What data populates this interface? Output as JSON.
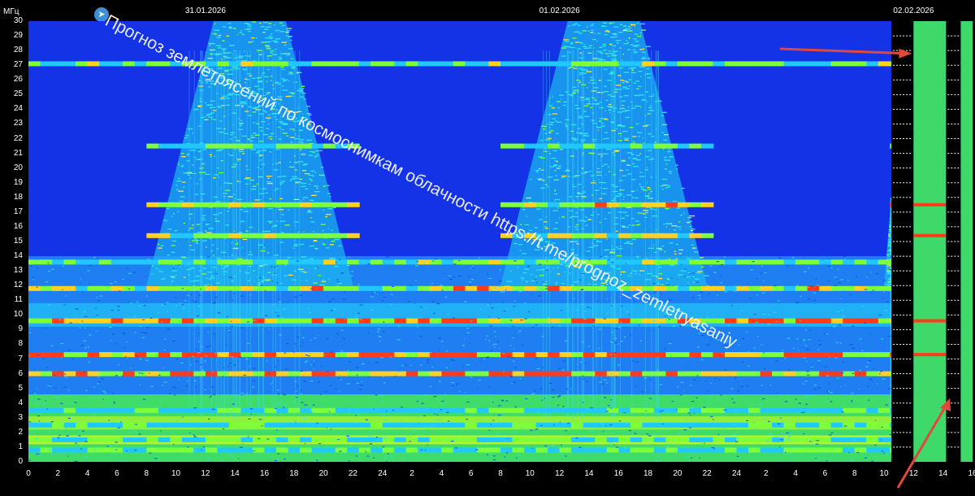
{
  "header": {
    "unit_label": "МГц",
    "dates": [
      "31.01.2026",
      "01.02.2026",
      "02.02.2026"
    ]
  },
  "watermark": {
    "text": "Прогноз землетрясений по космоснимкам облачности  https://t.me/prognoz_zemletryasaniy",
    "icon": "telegram-icon"
  },
  "colors": {
    "background": "#1433e6",
    "low": "#1a3fff",
    "mid": "#20c8ff",
    "high": "#7dff3a",
    "peak": "#ff3b1a",
    "gap": "#000000",
    "arrow": "#e0483a"
  },
  "chart_data": {
    "type": "heatmap",
    "title": "",
    "xlabel": "",
    "ylabel": "МГц",
    "ylim": [
      0,
      30
    ],
    "yticks": [
      "0",
      "1",
      "2",
      "3",
      "4",
      "5",
      "6",
      "7",
      "8",
      "9",
      "10",
      "11",
      "12",
      "13",
      "14",
      "15",
      "16",
      "17",
      "18",
      "19",
      "20",
      "21",
      "22",
      "23",
      "24",
      "25",
      "26",
      "27",
      "28",
      "29",
      "30"
    ],
    "xticks": [
      "0",
      "2",
      "4",
      "6",
      "8",
      "10",
      "12",
      "14",
      "16",
      "18",
      "20",
      "22",
      "24",
      "2",
      "4",
      "6",
      "8",
      "10",
      "12",
      "14",
      "16",
      "18",
      "20",
      "22",
      "24",
      "2",
      "4",
      "6",
      "8",
      "10",
      "12",
      "14",
      "16"
    ],
    "x_hours_total": 64,
    "date_markers": [
      {
        "label": "31.01.2026",
        "hour": 12
      },
      {
        "label": "01.02.2026",
        "hour": 36
      },
      {
        "label": "02.02.2026",
        "hour": 60
      }
    ],
    "strong_bands_mhz": [
      {
        "freq": 0.8,
        "intensity": 0.55
      },
      {
        "freq": 1.5,
        "intensity": 0.55
      },
      {
        "freq": 2.5,
        "intensity": 0.5
      },
      {
        "freq": 3.5,
        "intensity": 0.5
      },
      {
        "freq": 6.0,
        "intensity": 0.85
      },
      {
        "freq": 7.3,
        "intensity": 0.9
      },
      {
        "freq": 9.6,
        "intensity": 0.9
      },
      {
        "freq": 11.8,
        "intensity": 0.75
      },
      {
        "freq": 13.6,
        "intensity": 0.6
      },
      {
        "freq": 15.4,
        "intensity": 0.7
      },
      {
        "freq": 17.5,
        "intensity": 0.8
      },
      {
        "freq": 21.5,
        "intensity": 0.55
      },
      {
        "freq": 27.1,
        "intensity": 0.6
      }
    ],
    "daytime_activity_windows_hours": [
      [
        8,
        22
      ],
      [
        32,
        46
      ],
      [
        58,
        60
      ]
    ],
    "data_gaps_hours": [
      [
        58.5,
        60.0
      ],
      [
        62.2,
        63.2
      ]
    ],
    "annotations": [
      {
        "type": "arrow",
        "points_to_hour": 60,
        "points_to_mhz": 27.8
      },
      {
        "type": "arrow",
        "points_to_hour": 62.5,
        "points_to_mhz": 4.0
      }
    ]
  }
}
